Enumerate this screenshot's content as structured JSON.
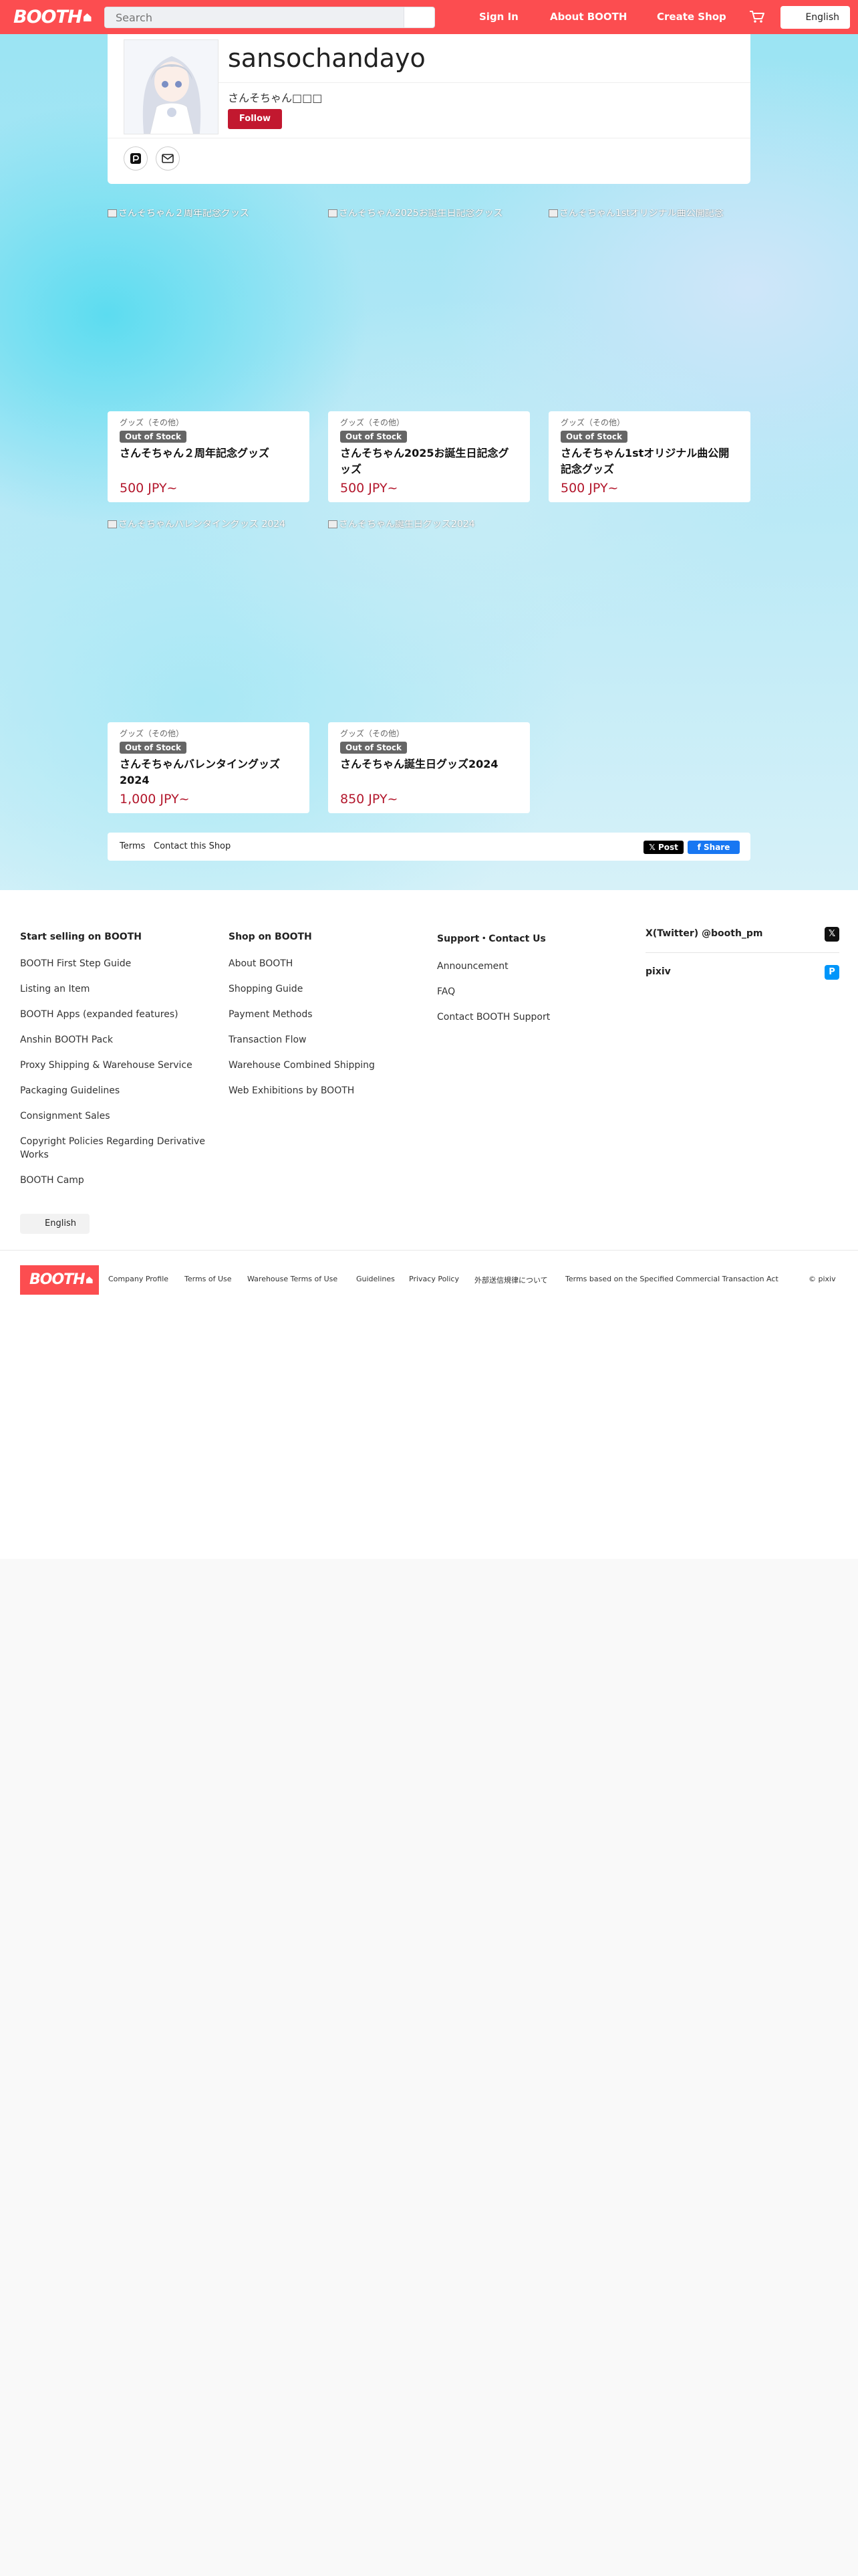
{
  "header": {
    "logo": "BOOTH",
    "search_placeholder": "Search",
    "sign_in": "Sign In",
    "about": "About BOOTH",
    "create_shop": "Create Shop",
    "language": "English"
  },
  "profile": {
    "shop_name": "sansochandayo",
    "subtitle": "さんそちゃん□□□",
    "follow": "Follow"
  },
  "products": [
    {
      "image_alt": "さんそちゃん２周年記念グッズ",
      "category": "グッズ（その他）",
      "badge": "Out of Stock",
      "name": "さんそちゃん２周年記念グッズ",
      "price": "500 JPY~"
    },
    {
      "image_alt": "さんそちゃん2025お誕生日記念グッズ",
      "category": "グッズ（その他）",
      "badge": "Out of Stock",
      "name": "さんそちゃん2025お誕生日記念グッズ",
      "price": "500 JPY~"
    },
    {
      "image_alt": "さんそちゃん1stオリジナル曲公開記念",
      "category": "グッズ（その他）",
      "badge": "Out of Stock",
      "name": "さんそちゃん1stオリジナル曲公開記念グッズ",
      "price": "500 JPY~"
    },
    {
      "image_alt": "さんそちゃんバレンタイングッズ 2024",
      "category": "グッズ（その他）",
      "badge": "Out of Stock",
      "name": "さんそちゃんバレンタイングッズ 2024",
      "price": "1,000 JPY~"
    },
    {
      "image_alt": "さんそちゃん誕生日グッズ2024",
      "category": "グッズ（その他）",
      "badge": "Out of Stock",
      "name": "さんそちゃん誕生日グッズ2024",
      "price": "850 JPY~"
    }
  ],
  "shop_footer": {
    "terms": "Terms",
    "contact": "Contact this Shop",
    "post": "𝕏 Post",
    "share": "f Share"
  },
  "footer": {
    "col1_title": "Start selling on BOOTH",
    "col1_links": [
      "BOOTH First Step Guide",
      "Listing an Item",
      "BOOTH Apps (expanded features)",
      "Anshin BOOTH Pack",
      "Proxy Shipping & Warehouse Service",
      "Packaging Guidelines",
      "Consignment Sales",
      "Copyright Policies Regarding Derivative Works",
      "BOOTH Camp"
    ],
    "col2_title": "Shop on BOOTH",
    "col2_links": [
      "About BOOTH",
      "Shopping Guide",
      "Payment Methods",
      "Transaction Flow",
      "Warehouse Combined Shipping",
      "Web Exhibitions by BOOTH"
    ],
    "col3_title": "Support・Contact Us",
    "col3_links": [
      "Announcement",
      "FAQ",
      "Contact BOOTH Support"
    ],
    "twitter": "X(Twitter) @booth_pm",
    "pixiv": "pixiv",
    "language": "English",
    "legal_links": [
      "Company Profile",
      "Terms of Use",
      "Warehouse Terms of Use",
      "Guidelines",
      "Privacy Policy",
      "外部送信規律について",
      "Terms based on the Specified Commercial Transaction Act"
    ],
    "copyright": "© pixiv"
  }
}
